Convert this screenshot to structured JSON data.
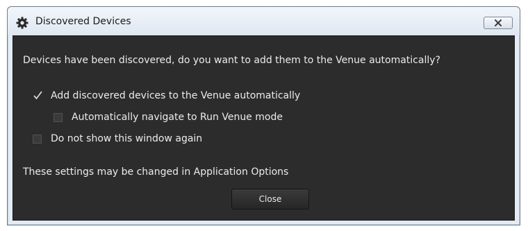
{
  "window": {
    "title": "Discovered Devices",
    "title_icon": "gear-icon",
    "close_icon": "close-icon"
  },
  "dialog": {
    "question": "Devices have been discovered, do you want to add them to the Venue automatically?",
    "options": [
      {
        "label": "Add discovered devices to the Venue automatically",
        "checked": true
      },
      {
        "label": "Automatically navigate to Run Venue mode",
        "checked": false
      },
      {
        "label": "Do not show this window again",
        "checked": false
      }
    ],
    "note": "These settings may be changed in Application Options",
    "close_label": "Close"
  },
  "colors": {
    "content_background": "#2c2c2c",
    "text": "#ececec",
    "titlebar": "#dfe7f2"
  }
}
